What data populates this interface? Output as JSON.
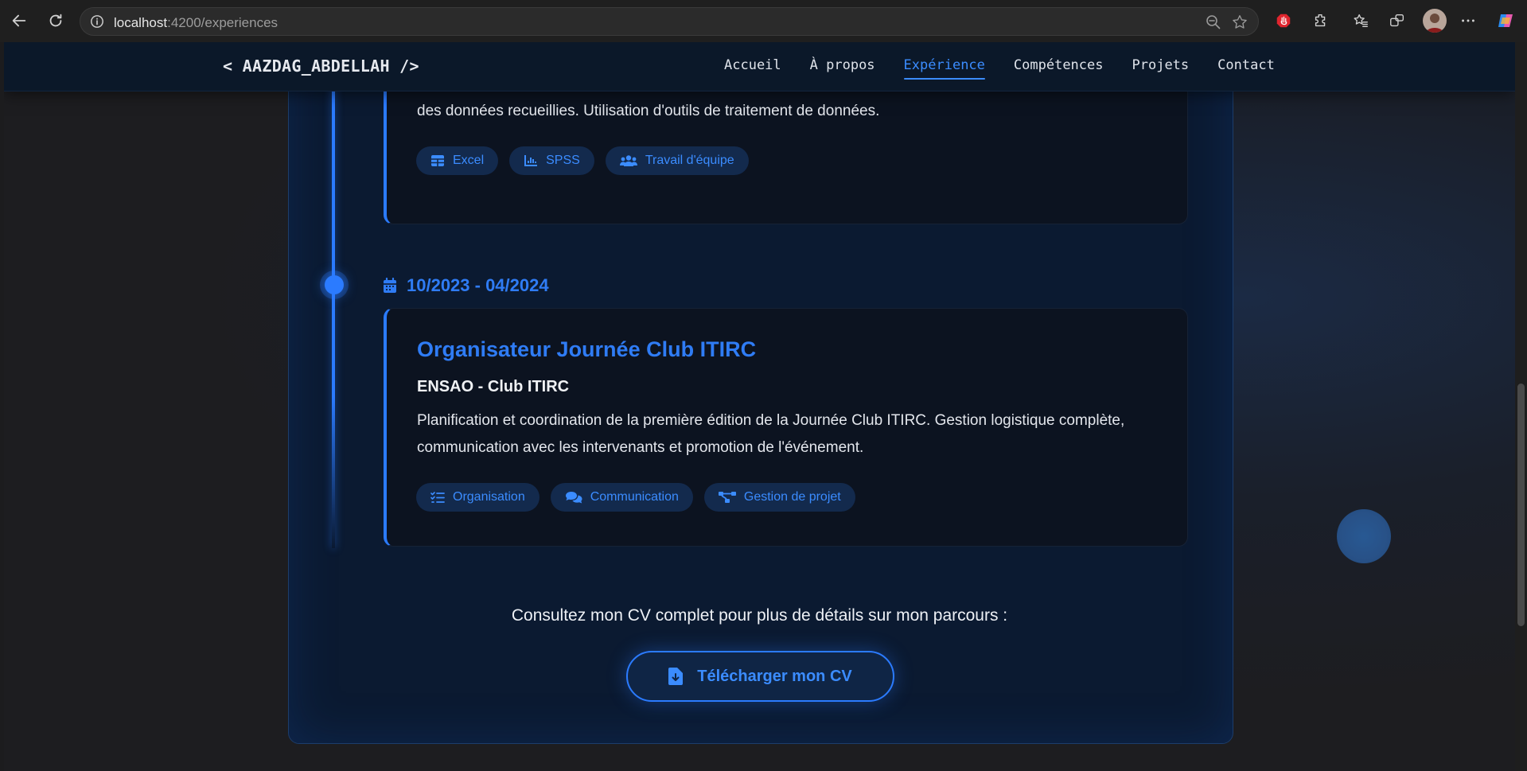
{
  "browser": {
    "url_host": "localhost",
    "url_path": ":4200/experiences"
  },
  "site": {
    "logo": "< AAZDAG_ABDELLAH />",
    "nav": [
      "Accueil",
      "À propos",
      "Expérience",
      "Compétences",
      "Projets",
      "Contact"
    ],
    "active_nav": "Expérience"
  },
  "experiences": [
    {
      "description": "Collecte et analyse de données statistiques sur le terrain. Coordination d'une équipe d'enquêteurs et validation des données recueillies. Utilisation d'outils de traitement de données.",
      "tags": [
        {
          "label": "Excel",
          "icon": "table-icon"
        },
        {
          "label": "SPSS",
          "icon": "chart-icon"
        },
        {
          "label": "Travail d'équipe",
          "icon": "users-icon"
        }
      ]
    },
    {
      "date": "10/2023 - 04/2024",
      "title": "Organisateur Journée Club ITIRC",
      "organization": "ENSAO - Club ITIRC",
      "description": "Planification et coordination de la première édition de la Journée Club ITIRC. Gestion logistique complète, communication avec les intervenants et promotion de l'événement.",
      "tags": [
        {
          "label": "Organisation",
          "icon": "list-check-icon"
        },
        {
          "label": "Communication",
          "icon": "comments-icon"
        },
        {
          "label": "Gestion de projet",
          "icon": "project-diagram-icon"
        }
      ]
    }
  ],
  "cv": {
    "prompt": "Consultez mon CV complet pour plus de détails sur mon parcours :",
    "button_label": "Télécharger mon CV"
  },
  "colors": {
    "accent": "#2b7bff",
    "header_bg": "#0b1829",
    "card_bg": "#0c1320"
  }
}
